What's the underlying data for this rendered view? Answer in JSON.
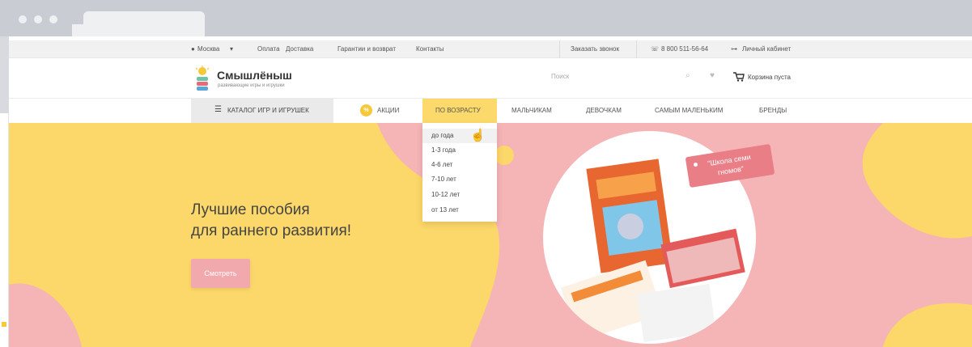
{
  "topbar": {
    "city": "Москва",
    "links": [
      "Оплата",
      "Доставка",
      "Гарантии и возврат",
      "Контакты"
    ],
    "callback": "Заказать звонок",
    "phone": "8 800 511-56-64",
    "account": "Личный кабинет"
  },
  "header": {
    "logo_title": "Смышлёныш",
    "logo_sub": "развивающие игры и игрушки",
    "search_placeholder": "Поиск",
    "cart": "Корзина пуста"
  },
  "nav": {
    "catalog": "КАТАЛОГ ИГР И ИГРУШЕК",
    "badge": "%",
    "items": [
      "АКЦИИ",
      "ПО ВОЗРАСТУ",
      "МАЛЬЧИКАМ",
      "ДЕВОЧКАМ",
      "САМЫМ МАЛЕНЬКИМ",
      "БРЕНДЫ"
    ]
  },
  "age_dropdown": [
    "до года",
    "1-3 года",
    "4-6 лет",
    "7-10 лет",
    "10-12 лет",
    "от 13 лет"
  ],
  "hero": {
    "line1": "Лучшие пособия",
    "line2": "для раннего развития!",
    "button": "Смотреть",
    "tag_line1": "\"Школа семи",
    "tag_line2": "гномов\""
  },
  "colors": {
    "hero_yellow": "#fcd769",
    "hero_pink": "#f5b4b6",
    "button_pink": "#f2a9ae",
    "tag_red": "#ea7e86",
    "nav_active": "#fbd96a"
  }
}
